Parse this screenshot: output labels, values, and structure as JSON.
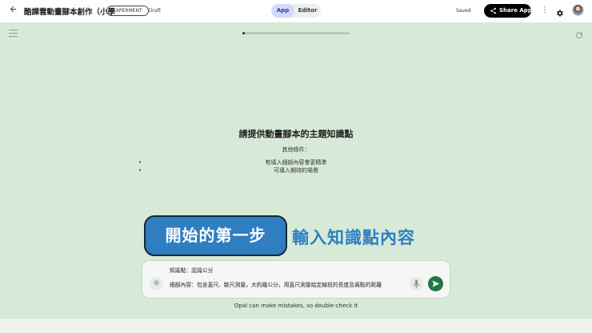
{
  "header": {
    "title": "酷課雲動畫腳本創作（小學",
    "badge": "EXPERMENT",
    "status": "Draft",
    "tabs": [
      "App",
      "Editor"
    ],
    "saved_label": "Saved",
    "share_label": "Share App"
  },
  "progress": {
    "fraction": 0.02
  },
  "main": {
    "heading": "請提供動畫腳本的主題知識點",
    "conditions_label": "其他條件：",
    "conditions": [
      "有填入細部內容會更精準",
      "可填入期待的場景"
    ]
  },
  "overlay": {
    "step_label": "開始的第一步",
    "step_text": "輸入知識點內容"
  },
  "input": {
    "line1": "知識點：認識公分",
    "line2": "細部內容：包含直尺、斷尺測量，大約幾公分，用直尺測量給定線段的長度及兩點的距離"
  },
  "disclaimer": "Opal can make mistakes, so double-check it",
  "colors": {
    "background": "#d6ead7",
    "accent": "#2f7ec1",
    "send": "#1e7a45",
    "app_tab": "#d3d9fb"
  },
  "icons": [
    "back-arrow-icon",
    "share-icon",
    "more-vert-icon",
    "gear-icon",
    "hamburger-icon",
    "refresh-icon",
    "add-icon",
    "mic-icon",
    "send-icon"
  ]
}
